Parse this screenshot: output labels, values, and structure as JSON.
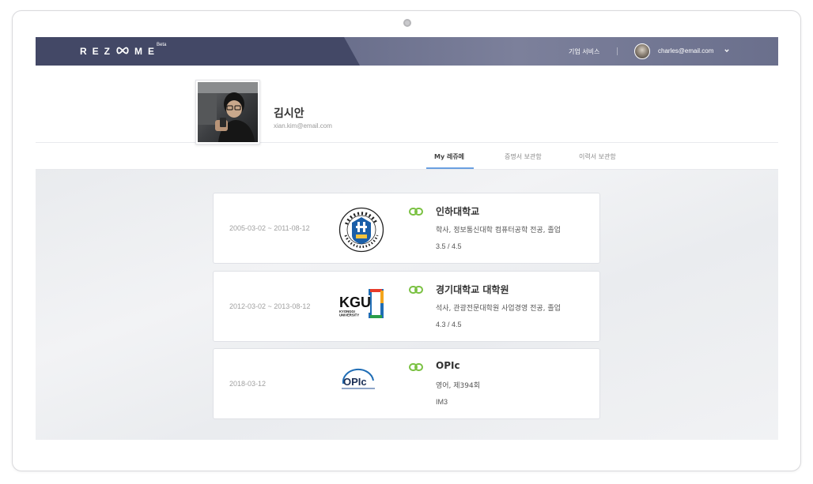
{
  "header": {
    "logo_text": "REZ ME",
    "beta_label": "Beta",
    "business_link": "기업 서비스",
    "user_email": "charles@email.com"
  },
  "profile": {
    "name": "김시안",
    "email": "xian.kim@email.com"
  },
  "tabs": [
    {
      "label": "My 레쥬메",
      "active": true
    },
    {
      "label": "증명서 보관함",
      "active": false
    },
    {
      "label": "이력서 보관함",
      "active": false
    }
  ],
  "cards": [
    {
      "date": "2005-03-02 ~ 2011-08-12",
      "title": "인하대학교",
      "subtitle": "학사, 정보통신대학 컴퓨터공학 전공, 졸업",
      "score": "3.5 / 4.5",
      "logo": "inha-university-seal"
    },
    {
      "date": "2012-03-02 ~ 2013-08-12",
      "title": "경기대학교 대학원",
      "subtitle": "석사, 관광전문대학원 사업경영 전공, 졸업",
      "score": "4.3 / 4.5",
      "logo": "kgu-logo",
      "logo_text": "KGU",
      "logo_sub1": "KYONGGI",
      "logo_sub2": "UNIVERSITY"
    },
    {
      "date": "2018-03-12",
      "title": "OPIc",
      "subtitle": "영어, 제394회",
      "score": "IM3",
      "logo": "opic-logo",
      "logo_text": "OPIc"
    }
  ],
  "colors": {
    "nav_dark": "#434866",
    "nav_light": "#7c809b",
    "tab_accent": "#6a9fe0",
    "link_green": "#7ac142"
  }
}
